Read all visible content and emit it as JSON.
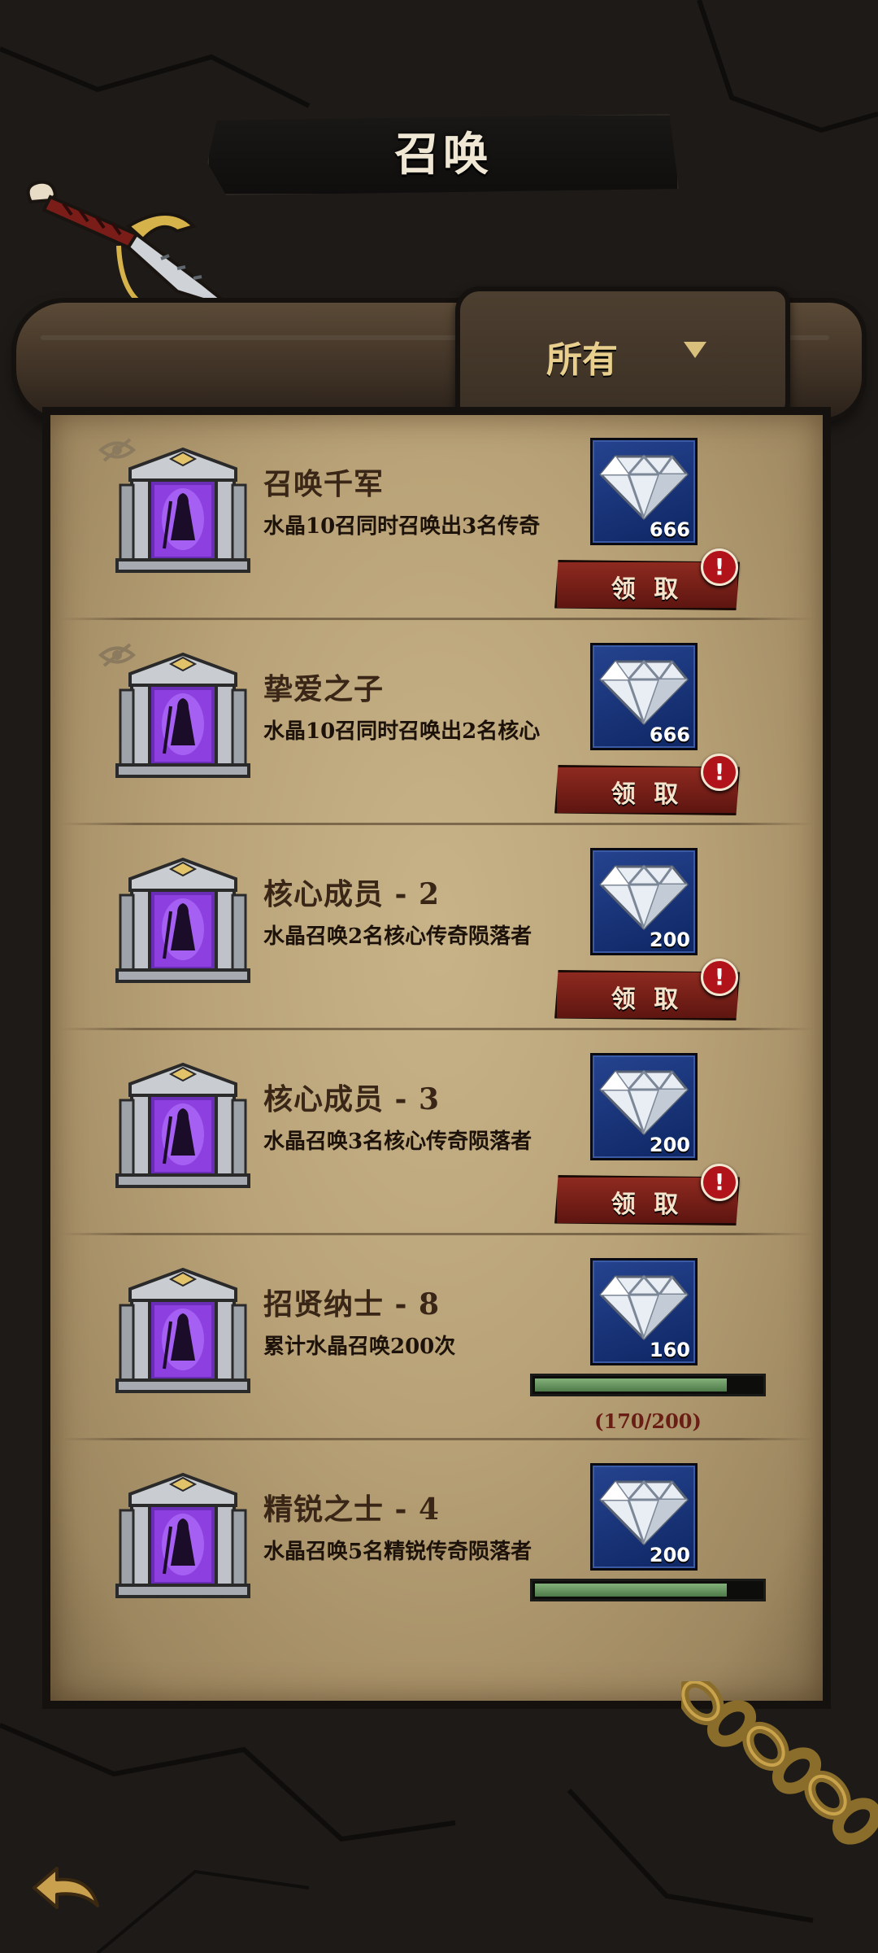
{
  "header": {
    "title": "召唤"
  },
  "filter": {
    "selected": "所有"
  },
  "quests": [
    {
      "title": "召唤千军",
      "description": "水晶10召同时召唤出3名传奇",
      "reward": "666",
      "status": "claimable",
      "claim_label": "领 取",
      "hidden_icon": true
    },
    {
      "title": "挚爱之子",
      "description": "水晶10召同时召唤出2名核心",
      "reward": "666",
      "status": "claimable",
      "claim_label": "领 取",
      "hidden_icon": true
    },
    {
      "title": "核心成员 - 2",
      "description": "水晶召唤2名核心传奇陨落者",
      "reward": "200",
      "status": "claimable",
      "claim_label": "领 取",
      "hidden_icon": false
    },
    {
      "title": "核心成员 - 3",
      "description": "水晶召唤3名核心传奇陨落者",
      "reward": "200",
      "status": "claimable",
      "claim_label": "领 取",
      "hidden_icon": false
    },
    {
      "title": "招贤纳士 - 8",
      "description": "累计水晶召唤200次",
      "reward": "160",
      "status": "in_progress",
      "progress_text": "(170/200)",
      "progress": 0.85,
      "hidden_icon": false
    },
    {
      "title": "精锐之士 - 4",
      "description": "水晶召唤5名精锐传奇陨落者",
      "reward": "200",
      "status": "in_progress",
      "progress": 0.85,
      "hidden_icon": false
    }
  ],
  "alert_glyph": "!",
  "colors": {
    "reward_bg": "#1b3a86",
    "claim_button": "#7d2219",
    "progress_fill": "#5e8c58",
    "parchment": "#b9a277"
  }
}
